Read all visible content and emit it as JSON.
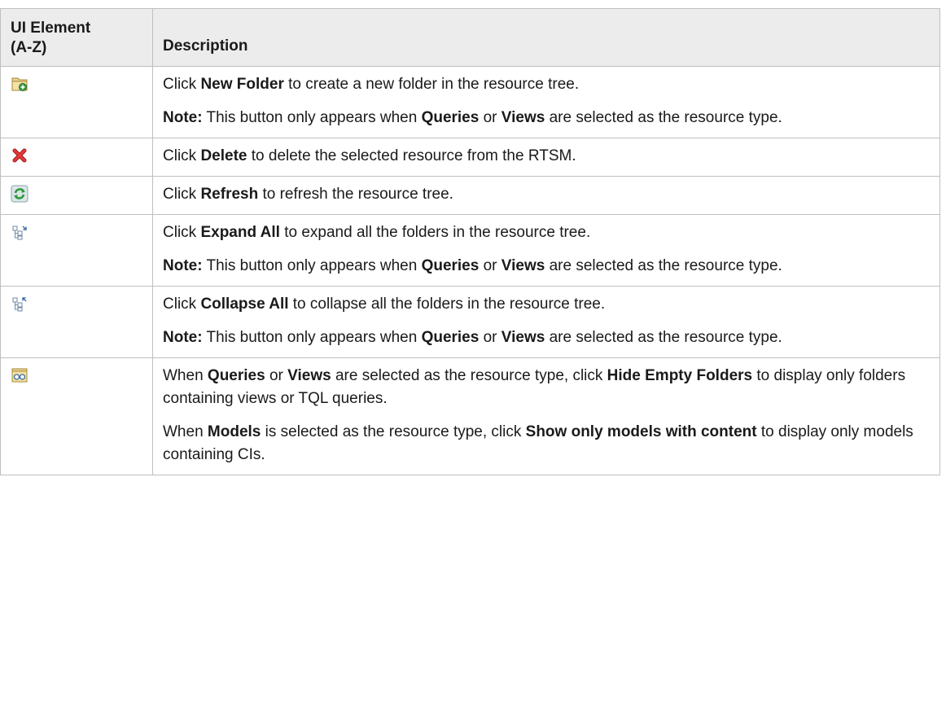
{
  "header": {
    "col1_line1": "UI Element",
    "col1_line2": "(A-Z)",
    "col2": "Description"
  },
  "rows": [
    {
      "icon": "new-folder-icon",
      "desc": [
        [
          {
            "t": "Click ",
            "b": false
          },
          {
            "t": "New Folder",
            "b": true
          },
          {
            "t": " to create a new folder in the resource tree.",
            "b": false
          }
        ],
        [
          {
            "t": "Note:",
            "b": true
          },
          {
            "t": " This button only appears when ",
            "b": false
          },
          {
            "t": "Queries",
            "b": true
          },
          {
            "t": " or ",
            "b": false
          },
          {
            "t": "Views",
            "b": true
          },
          {
            "t": " are selected as the resource type.",
            "b": false
          }
        ]
      ]
    },
    {
      "icon": "delete-icon",
      "desc": [
        [
          {
            "t": "Click ",
            "b": false
          },
          {
            "t": "Delete",
            "b": true
          },
          {
            "t": " to delete the selected resource from the RTSM.",
            "b": false
          }
        ]
      ]
    },
    {
      "icon": "refresh-icon",
      "desc": [
        [
          {
            "t": "Click ",
            "b": false
          },
          {
            "t": "Refresh",
            "b": true
          },
          {
            "t": " to refresh the resource tree.",
            "b": false
          }
        ]
      ]
    },
    {
      "icon": "expand-all-icon",
      "desc": [
        [
          {
            "t": "Click ",
            "b": false
          },
          {
            "t": "Expand All",
            "b": true
          },
          {
            "t": " to expand all the folders in the resource tree.",
            "b": false
          }
        ],
        [
          {
            "t": "Note:",
            "b": true
          },
          {
            "t": " This button only appears when ",
            "b": false
          },
          {
            "t": "Queries",
            "b": true
          },
          {
            "t": " or ",
            "b": false
          },
          {
            "t": "Views",
            "b": true
          },
          {
            "t": " are selected as the resource type.",
            "b": false
          }
        ]
      ]
    },
    {
      "icon": "collapse-all-icon",
      "desc": [
        [
          {
            "t": "Click ",
            "b": false
          },
          {
            "t": "Collapse All",
            "b": true
          },
          {
            "t": " to collapse all the folders in the resource tree.",
            "b": false
          }
        ],
        [
          {
            "t": "Note:",
            "b": true
          },
          {
            "t": " This button only appears when ",
            "b": false
          },
          {
            "t": "Queries",
            "b": true
          },
          {
            "t": " or ",
            "b": false
          },
          {
            "t": "Views",
            "b": true
          },
          {
            "t": " are selected as the resource type.",
            "b": false
          }
        ]
      ]
    },
    {
      "icon": "hide-empty-folders-icon",
      "desc": [
        [
          {
            "t": "When ",
            "b": false
          },
          {
            "t": "Queries",
            "b": true
          },
          {
            "t": " or ",
            "b": false
          },
          {
            "t": "Views",
            "b": true
          },
          {
            "t": " are selected as the resource type, click ",
            "b": false
          },
          {
            "t": "Hide Empty Folders",
            "b": true
          },
          {
            "t": " to display only folders containing views or TQL queries.",
            "b": false
          }
        ],
        [
          {
            "t": "When ",
            "b": false
          },
          {
            "t": "Models",
            "b": true
          },
          {
            "t": " is selected as the resource type, click ",
            "b": false
          },
          {
            "t": "Show only models with content",
            "b": true
          },
          {
            "t": " to display only models containing CIs.",
            "b": false
          }
        ]
      ]
    }
  ]
}
